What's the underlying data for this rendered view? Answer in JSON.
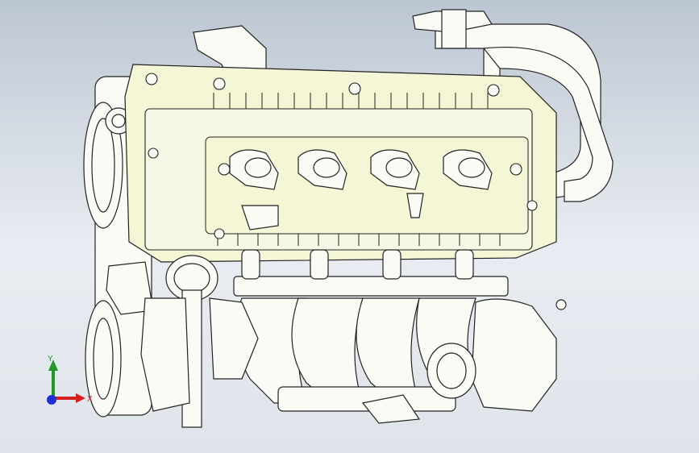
{
  "viewport": {
    "background_top": "#bcc6d2",
    "background_bottom": "#e9edf2"
  },
  "model": {
    "head_color": "#f4f6d6",
    "part_color": "#fbfbf6",
    "edge_color": "#222222"
  },
  "triad": {
    "x_label": "X",
    "y_label": "Y",
    "x_color": "#d62020",
    "y_color": "#1f9a2a",
    "z_color": "#1d2fd6"
  }
}
